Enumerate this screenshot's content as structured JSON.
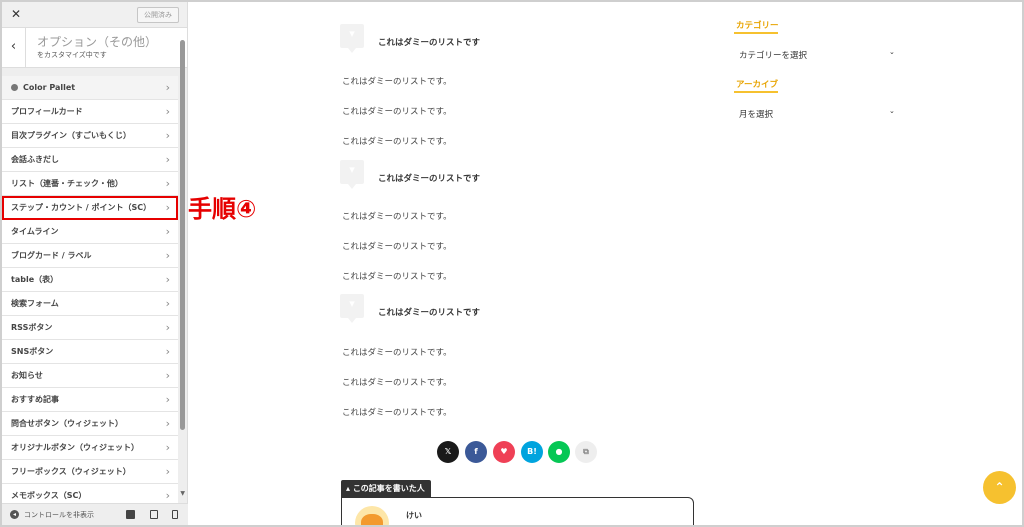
{
  "sidebar": {
    "close_glyph": "✕",
    "publish_label": "公開済み",
    "back_glyph": "‹",
    "section_title": "オプション（その他）",
    "subtitle": "をカスタマイズ中です",
    "items": [
      {
        "label": "Color Pallet"
      },
      {
        "label": "プロフィールカード"
      },
      {
        "label": "目次プラグイン（すごいもくじ）"
      },
      {
        "label": "会話ふきだし"
      },
      {
        "label": "リスト（連番・チェック・他）"
      },
      {
        "label": "ステップ・カウント / ポイント（SC）"
      },
      {
        "label": "タイムライン"
      },
      {
        "label": "ブログカード / ラベル"
      },
      {
        "label": "table（表）"
      },
      {
        "label": "検索フォーム"
      },
      {
        "label": "RSSボタン"
      },
      {
        "label": "SNSボタン"
      },
      {
        "label": "お知らせ"
      },
      {
        "label": "おすすめ記事"
      },
      {
        "label": "問合せボタン（ウィジェット）"
      },
      {
        "label": "オリジナルボタン（ウィジェット）"
      },
      {
        "label": "フリーボックス（ウィジェット）"
      },
      {
        "label": "メモボックス（SC）"
      }
    ],
    "chevron_glyph": "›",
    "footer_hide_label": "コントロールを非表示",
    "highlight_color": "#e60000"
  },
  "annotation": {
    "step_label": "手順④"
  },
  "content": {
    "lists": [
      {
        "title": "これはダミーのリストです",
        "lines": [
          "これはダミーのリストです。",
          "これはダミーのリストです。",
          "これはダミーのリストです。"
        ]
      },
      {
        "title": "これはダミーのリストです",
        "lines": [
          "これはダミーのリストです。",
          "これはダミーのリストです。",
          "これはダミーのリストです。"
        ]
      },
      {
        "title": "これはダミーのリストです",
        "lines": [
          "これはダミーのリストです。",
          "これはダミーのリストです。",
          "これはダミーのリストです。"
        ]
      }
    ],
    "share_buttons": [
      {
        "icon": "x-icon",
        "glyph": "𝕏",
        "color": "#1a1a1a"
      },
      {
        "icon": "facebook-icon",
        "glyph": "f",
        "color": "#3b5998"
      },
      {
        "icon": "pocket-icon",
        "glyph": "♥",
        "color": "#ef4056"
      },
      {
        "icon": "hatena-icon",
        "glyph": "B!",
        "color": "#00a4de"
      },
      {
        "icon": "line-icon",
        "glyph": "●",
        "color": "#06c755"
      },
      {
        "icon": "copy-icon",
        "glyph": "⧉",
        "color": "#eeeeee"
      }
    ],
    "author_tag": "この記事を書いた人",
    "author_name": "けい"
  },
  "widgets": {
    "category": {
      "title": "カテゴリー",
      "select": "カテゴリーを選択"
    },
    "archive": {
      "title": "アーカイブ",
      "select": "月を選択"
    },
    "caret_glyph": "⌄",
    "accent_color": "#f6c12f"
  },
  "to_top_glyph": "⌃"
}
